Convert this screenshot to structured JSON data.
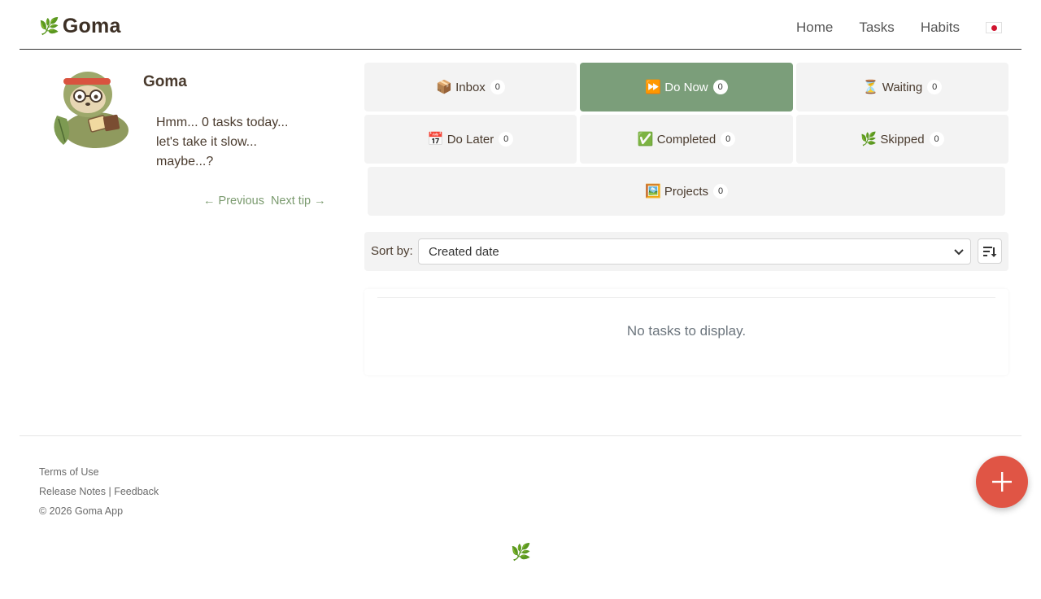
{
  "brand": {
    "name": "Goma",
    "icon": "leaf-icon"
  },
  "nav": {
    "home": "Home",
    "tasks": "Tasks",
    "habits": "Habits",
    "language_icon": "japan-flag-icon"
  },
  "tip": {
    "name": "Goma",
    "lines": [
      "Hmm... 0 tasks today...",
      "let's take it slow...",
      "maybe...?"
    ],
    "previous": "← Previous",
    "next": "Next tip →"
  },
  "tiles": {
    "inbox": {
      "emoji": "📦",
      "label": "Inbox",
      "count": "0"
    },
    "do_now": {
      "emoji": "⏩",
      "label": "Do Now",
      "count": "0",
      "active": true
    },
    "waiting": {
      "emoji": "⏳",
      "label": "Waiting",
      "count": "0"
    },
    "do_later": {
      "emoji": "📅",
      "label": "Do Later",
      "count": "0"
    },
    "completed": {
      "emoji": "✅",
      "label": "Completed",
      "count": "0"
    },
    "skipped": {
      "emoji": "🌿",
      "label": "Skipped",
      "count": "0"
    },
    "projects": {
      "emoji": "🖼️",
      "label": "Projects",
      "count": "0"
    }
  },
  "sort": {
    "label": "Sort by:",
    "selected": "Created date"
  },
  "tasks": {
    "empty_message": "No tasks to display."
  },
  "footer": {
    "terms": "Terms of Use",
    "release_notes": "Release Notes",
    "separator": "|",
    "feedback": "Feedback",
    "copyright": "© 2026 Goma App",
    "leaf": "🌿"
  },
  "colors": {
    "accent": "#7b9e7a",
    "fab": "#e05545",
    "text": "#4a3b2e"
  }
}
